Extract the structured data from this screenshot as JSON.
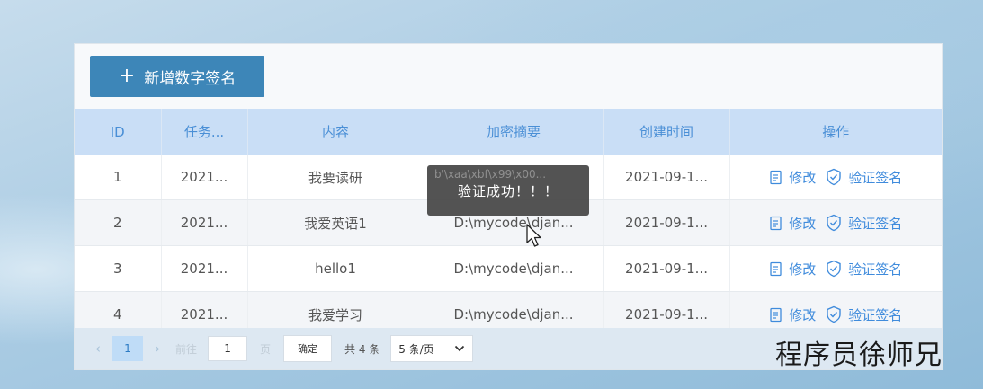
{
  "toolbar": {
    "add_label": "新增数字签名"
  },
  "table": {
    "headers": [
      "ID",
      "任务...",
      "内容",
      "加密摘要",
      "创建时间",
      "操作"
    ],
    "rows": [
      {
        "id": "1",
        "task": "2021...",
        "content": "我要读研",
        "digest": "",
        "created": "2021-09-1..."
      },
      {
        "id": "2",
        "task": "2021...",
        "content": "我爱英语1",
        "digest": "D:\\mycode\\djan...",
        "created": "2021-09-1..."
      },
      {
        "id": "3",
        "task": "2021...",
        "content": "hello1",
        "digest": "D:\\mycode\\djan...",
        "created": "2021-09-1..."
      },
      {
        "id": "4",
        "task": "2021...",
        "content": "我爱学习",
        "digest": "D:\\mycode\\djan...",
        "created": "2021-09-1..."
      }
    ],
    "actions": {
      "edit_label": "修改",
      "verify_label": "验证签名"
    }
  },
  "toast": {
    "ghost_text": "b'\\xaa\\xbf\\x99\\x00...",
    "message": "验证成功！！！"
  },
  "pagination": {
    "current_page": "1",
    "goto_label": "前往",
    "goto_value": "1",
    "page_unit": "页",
    "confirm_label": "确定",
    "total_label": "共 4 条",
    "page_size": "5 条/页"
  },
  "watermark": "程序员徐师兄",
  "colors": {
    "primary": "#3d86b8",
    "header_bg": "#c9def6",
    "link": "#3f8bdc",
    "toast_bg": "#464646"
  }
}
